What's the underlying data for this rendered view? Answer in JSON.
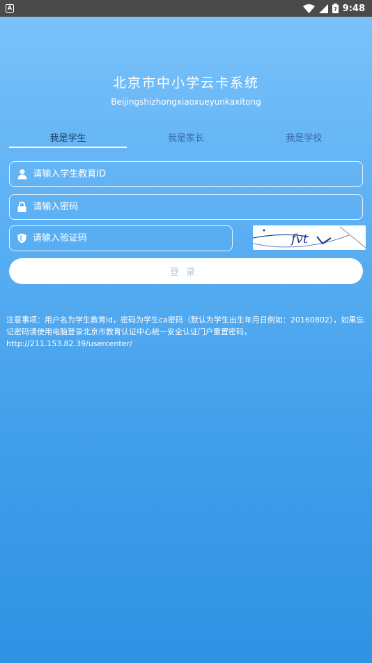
{
  "status_bar": {
    "notification_icon": "android-notification-icon",
    "time": "9:48"
  },
  "app": {
    "title": "北京市中小学云卡系统",
    "subtitle": "Beijingshizhongxiaoxueyunkaxitong"
  },
  "tabs": [
    {
      "label": "我是学生",
      "active": true
    },
    {
      "label": "我是家长",
      "active": false
    },
    {
      "label": "我是学校",
      "active": false
    }
  ],
  "form": {
    "student_id_placeholder": "请输入学生教育ID",
    "password_placeholder": "请输入密码",
    "captcha_placeholder": "请输入验证码",
    "captcha_text": "fvt",
    "login_label": "登录"
  },
  "notice": {
    "text": "注意事项：用户名为学生教育id，密码为学生ca密码（默认为学生出生年月日例如：20160802），如果忘记密码请使用电脑登录北京市教育认证中心统一安全认证门户重置密码，http://211.153.82.39/usercenter/"
  },
  "colors": {
    "status_bar": "#4a4a4a",
    "gradient_top": "#7cc3fb",
    "gradient_bottom": "#2f92e4",
    "tab_active": "#1f3d66",
    "button_bg": "#ffffff",
    "button_text": "#b0c8e0"
  }
}
